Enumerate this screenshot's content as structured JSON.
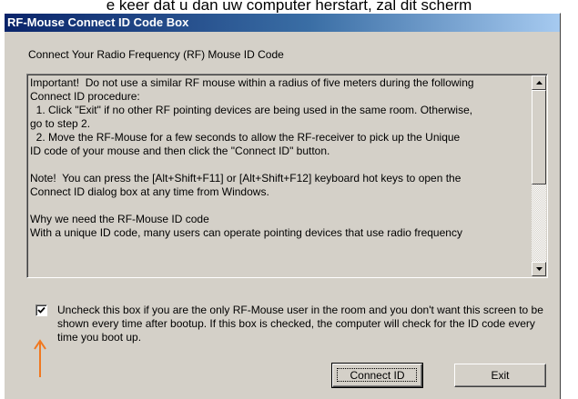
{
  "caption": "e keer dat u dan uw computer herstart, zal dit scherm",
  "window": {
    "title": "RF-Mouse Connect ID Code Box"
  },
  "heading": "Connect Your Radio Frequency (RF) Mouse ID Code",
  "info": {
    "lines": [
      "Important!  Do not use a similar RF mouse within a radius of five meters during the following",
      "Connect ID procedure:",
      "  1. Click \"Exit\" if no other RF pointing devices are being used in the same room. Otherwise,",
      "go to step 2.",
      "  2. Move the RF-Mouse for a few seconds to allow the RF-receiver to pick up the Unique",
      "ID code of your mouse and then click the \"Connect ID\" button.",
      "",
      "Note!  You can press the [Alt+Shift+F11] or [Alt+Shift+F12] keyboard hot keys to open the",
      "Connect ID dialog box at any time from Windows.",
      "",
      "Why we need the RF-Mouse ID code",
      "With a unique ID code, many users can operate pointing devices that use radio frequency"
    ]
  },
  "checkbox": {
    "checked": true,
    "label": "Uncheck this box if you are the only RF-Mouse user in the room and you don't want this screen to be shown every time after bootup. If this box is checked, the computer will check for the ID code every time you boot up."
  },
  "buttons": {
    "connect": "Connect ID",
    "exit": "Exit"
  },
  "colors": {
    "title_start": "#0a246a",
    "title_end": "#a6caf0",
    "dialog_bg": "#d4d0c8",
    "arrow": "#f07820"
  },
  "icons": {
    "scroll_up": "triangle-up-icon",
    "scroll_down": "triangle-down-icon",
    "check": "checkmark-icon",
    "annotation": "arrow-up-icon"
  }
}
